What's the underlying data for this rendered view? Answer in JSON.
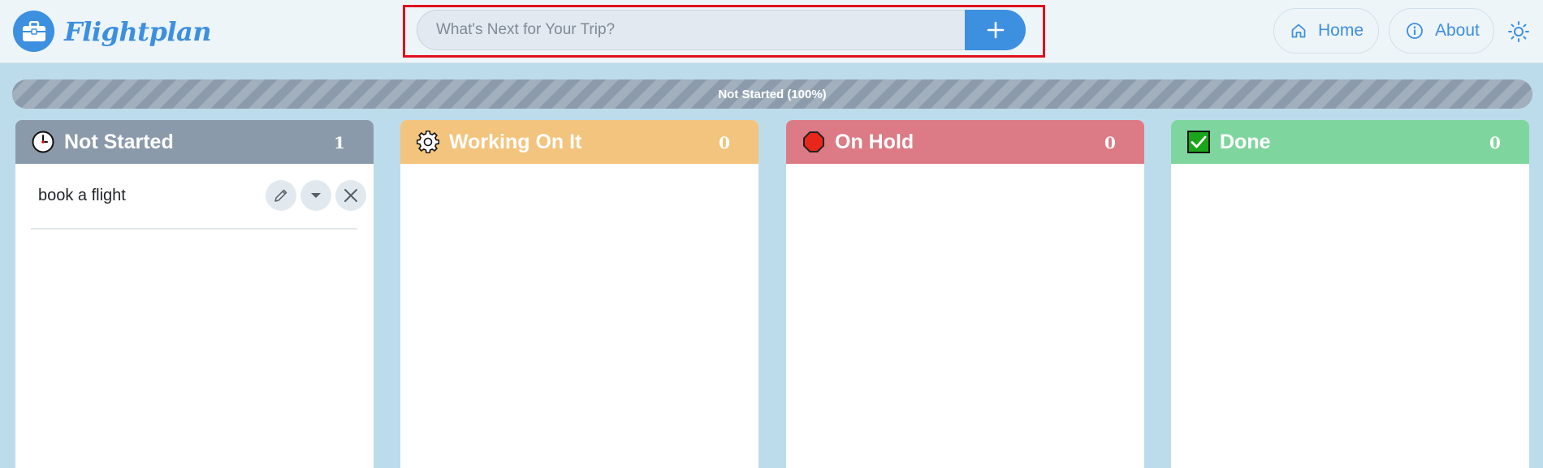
{
  "app": {
    "name": "Flightplan",
    "brand_color": "#3d8fe0"
  },
  "search": {
    "placeholder": "What's Next for Your Trip?",
    "value": "",
    "add_icon": "plus-icon"
  },
  "nav": {
    "home_label": "Home",
    "home_icon": "home-icon",
    "about_label": "About",
    "about_icon": "info-icon",
    "theme_icon": "sun-icon"
  },
  "progress": {
    "label": "Not Started (100%)",
    "fraction": 1.0
  },
  "columns": [
    {
      "title": "Not Started",
      "count": "1",
      "icon": "clock-icon",
      "color": "#8b9aab",
      "tasks": [
        {
          "text": "book a flight",
          "actions": [
            "pencil-icon",
            "caret-down-icon",
            "close-icon"
          ]
        }
      ]
    },
    {
      "title": "Working On It",
      "count": "0",
      "icon": "gear-icon",
      "color": "#f3c47d",
      "tasks": []
    },
    {
      "title": "On Hold",
      "count": "0",
      "icon": "stop-sign-icon",
      "color": "#dc7b86",
      "tasks": []
    },
    {
      "title": "Done",
      "count": "0",
      "icon": "checkbox-icon",
      "color": "#7ed69e",
      "tasks": []
    }
  ]
}
